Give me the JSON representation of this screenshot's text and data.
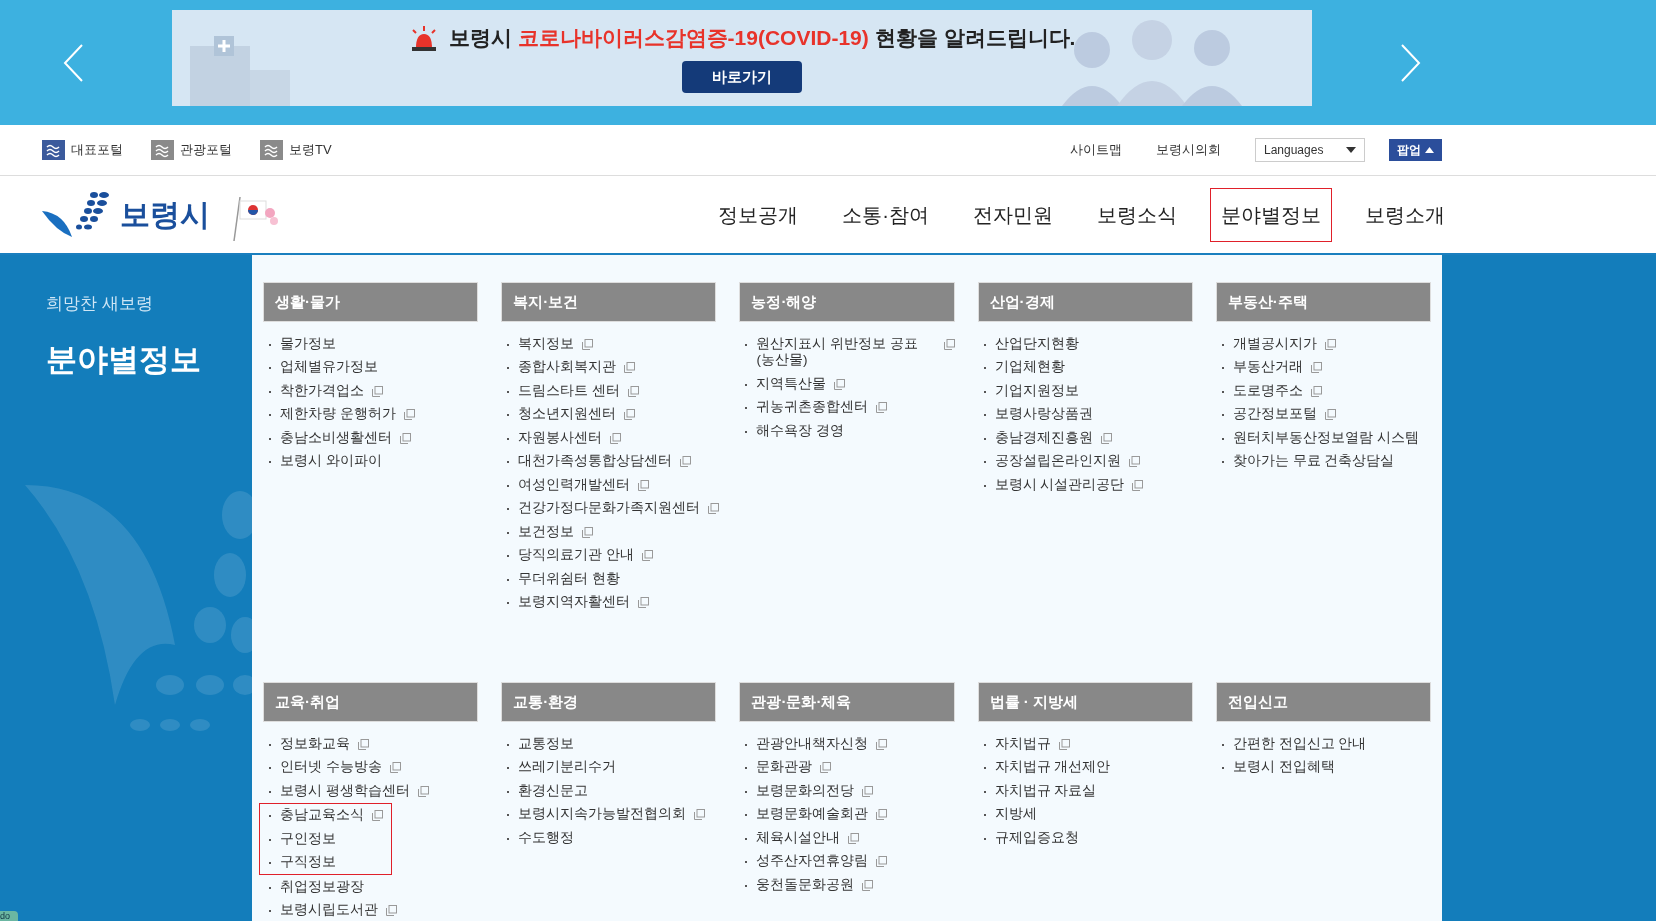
{
  "banner": {
    "title_prefix": "보령시",
    "title_highlight": "코로나바이러스감염증-19(COVID-19)",
    "title_suffix": "현황을 알려드립니다.",
    "button": "바로가기"
  },
  "portal_links": [
    {
      "label": "대표포털",
      "selected": true
    },
    {
      "label": "관광포털",
      "selected": false
    },
    {
      "label": "보령TV",
      "selected": false
    }
  ],
  "utility_links": [
    "사이트맵",
    "보령시의회"
  ],
  "language_select": {
    "value": "Languages"
  },
  "popup_button": "팝업",
  "logo_text": "보령시",
  "main_nav": [
    {
      "label": "정보공개",
      "selected": false
    },
    {
      "label": "소통·참여",
      "selected": false
    },
    {
      "label": "전자민원",
      "selected": false
    },
    {
      "label": "보령소식",
      "selected": false
    },
    {
      "label": "분야별정보",
      "selected": true
    },
    {
      "label": "보령소개",
      "selected": false
    }
  ],
  "sidebar": {
    "slogan": "희망찬 새보령",
    "title": "분야별정보"
  },
  "menu_sections": [
    {
      "title": "생활·물가",
      "items": [
        {
          "label": "물가정보",
          "external": false,
          "highlighted": false
        },
        {
          "label": "업체별유가정보",
          "external": false,
          "highlighted": false
        },
        {
          "label": "착한가격업소",
          "external": true,
          "highlighted": false
        },
        {
          "label": "제한차량 운행허가",
          "external": true,
          "highlighted": false
        },
        {
          "label": "충남소비생활센터",
          "external": true,
          "highlighted": false
        },
        {
          "label": "보령시 와이파이",
          "external": false,
          "highlighted": false
        }
      ]
    },
    {
      "title": "복지·보건",
      "items": [
        {
          "label": "복지정보",
          "external": true,
          "highlighted": false
        },
        {
          "label": "종합사회복지관",
          "external": true,
          "highlighted": false
        },
        {
          "label": "드림스타트 센터",
          "external": true,
          "highlighted": false
        },
        {
          "label": "청소년지원센터",
          "external": true,
          "highlighted": false
        },
        {
          "label": "자원봉사센터",
          "external": true,
          "highlighted": false
        },
        {
          "label": "대천가족성통합상담센터",
          "external": true,
          "highlighted": false
        },
        {
          "label": "여성인력개발센터",
          "external": true,
          "highlighted": false
        },
        {
          "label": "건강가정다문화가족지원센터",
          "external": true,
          "highlighted": false
        },
        {
          "label": "보건정보",
          "external": true,
          "highlighted": false
        },
        {
          "label": "당직의료기관 안내",
          "external": true,
          "highlighted": false
        },
        {
          "label": "무더위쉼터 현황",
          "external": false,
          "highlighted": false
        },
        {
          "label": "보령지역자활센터",
          "external": true,
          "highlighted": false
        }
      ]
    },
    {
      "title": "농정·해양",
      "items": [
        {
          "label": "원산지표시 위반정보 공표(농산물)",
          "external": true,
          "highlighted": false
        },
        {
          "label": "지역특산물",
          "external": true,
          "highlighted": false
        },
        {
          "label": "귀농귀촌종합센터",
          "external": true,
          "highlighted": false
        },
        {
          "label": "해수욕장 경영",
          "external": false,
          "highlighted": false
        }
      ]
    },
    {
      "title": "산업·경제",
      "items": [
        {
          "label": "산업단지현황",
          "external": false,
          "highlighted": false
        },
        {
          "label": "기업체현황",
          "external": false,
          "highlighted": false
        },
        {
          "label": "기업지원정보",
          "external": false,
          "highlighted": false
        },
        {
          "label": "보령사랑상품권",
          "external": false,
          "highlighted": false
        },
        {
          "label": "충남경제진흥원",
          "external": true,
          "highlighted": false
        },
        {
          "label": "공장설립온라인지원",
          "external": true,
          "highlighted": false
        },
        {
          "label": "보령시 시설관리공단",
          "external": true,
          "highlighted": false
        }
      ]
    },
    {
      "title": "부동산·주택",
      "items": [
        {
          "label": "개별공시지가",
          "external": true,
          "highlighted": false
        },
        {
          "label": "부동산거래",
          "external": true,
          "highlighted": false
        },
        {
          "label": "도로명주소",
          "external": true,
          "highlighted": false
        },
        {
          "label": "공간정보포털",
          "external": true,
          "highlighted": false
        },
        {
          "label": "원터치부동산정보열람 시스템",
          "external": false,
          "highlighted": false
        },
        {
          "label": "찾아가는 무료 건축상담실",
          "external": false,
          "highlighted": false
        }
      ]
    },
    {
      "title": "교육·취업",
      "items": [
        {
          "label": "정보화교육",
          "external": true,
          "highlighted": false
        },
        {
          "label": "인터넷 수능방송",
          "external": true,
          "highlighted": false
        },
        {
          "label": "보령시 평생학습센터",
          "external": true,
          "highlighted": false
        },
        {
          "label": "충남교육소식",
          "external": true,
          "highlighted": true
        },
        {
          "label": "구인정보",
          "external": false,
          "highlighted": true
        },
        {
          "label": "구직정보",
          "external": false,
          "highlighted": true
        },
        {
          "label": "취업정보광장",
          "external": false,
          "highlighted": false
        },
        {
          "label": "보령시립도서관",
          "external": true,
          "highlighted": false
        }
      ]
    },
    {
      "title": "교통·환경",
      "items": [
        {
          "label": "교통정보",
          "external": false,
          "highlighted": false
        },
        {
          "label": "쓰레기분리수거",
          "external": false,
          "highlighted": false
        },
        {
          "label": "환경신문고",
          "external": false,
          "highlighted": false
        },
        {
          "label": "보령시지속가능발전협의회",
          "external": true,
          "highlighted": false
        },
        {
          "label": "수도행정",
          "external": false,
          "highlighted": false
        }
      ]
    },
    {
      "title": "관광·문화·체육",
      "items": [
        {
          "label": "관광안내책자신청",
          "external": true,
          "highlighted": false
        },
        {
          "label": "문화관광",
          "external": true,
          "highlighted": false
        },
        {
          "label": "보령문화의전당",
          "external": true,
          "highlighted": false
        },
        {
          "label": "보령문화예술회관",
          "external": true,
          "highlighted": false
        },
        {
          "label": "체육시설안내",
          "external": true,
          "highlighted": false
        },
        {
          "label": "성주산자연휴양림",
          "external": true,
          "highlighted": false
        },
        {
          "label": "웅천돌문화공원",
          "external": true,
          "highlighted": false
        }
      ]
    },
    {
      "title": "법률 · 지방세",
      "items": [
        {
          "label": "자치법규",
          "external": true,
          "highlighted": false
        },
        {
          "label": "자치법규 개선제안",
          "external": false,
          "highlighted": false
        },
        {
          "label": "자치법규 자료실",
          "external": false,
          "highlighted": false
        },
        {
          "label": "지방세",
          "external": false,
          "highlighted": false
        },
        {
          "label": "규제입증요청",
          "external": false,
          "highlighted": false
        }
      ]
    },
    {
      "title": "전입신고",
      "items": [
        {
          "label": "간편한 전입신고 안내",
          "external": false,
          "highlighted": false
        },
        {
          "label": "보령시 전입혜택",
          "external": false,
          "highlighted": false
        }
      ]
    }
  ],
  "corner_badge": "do"
}
